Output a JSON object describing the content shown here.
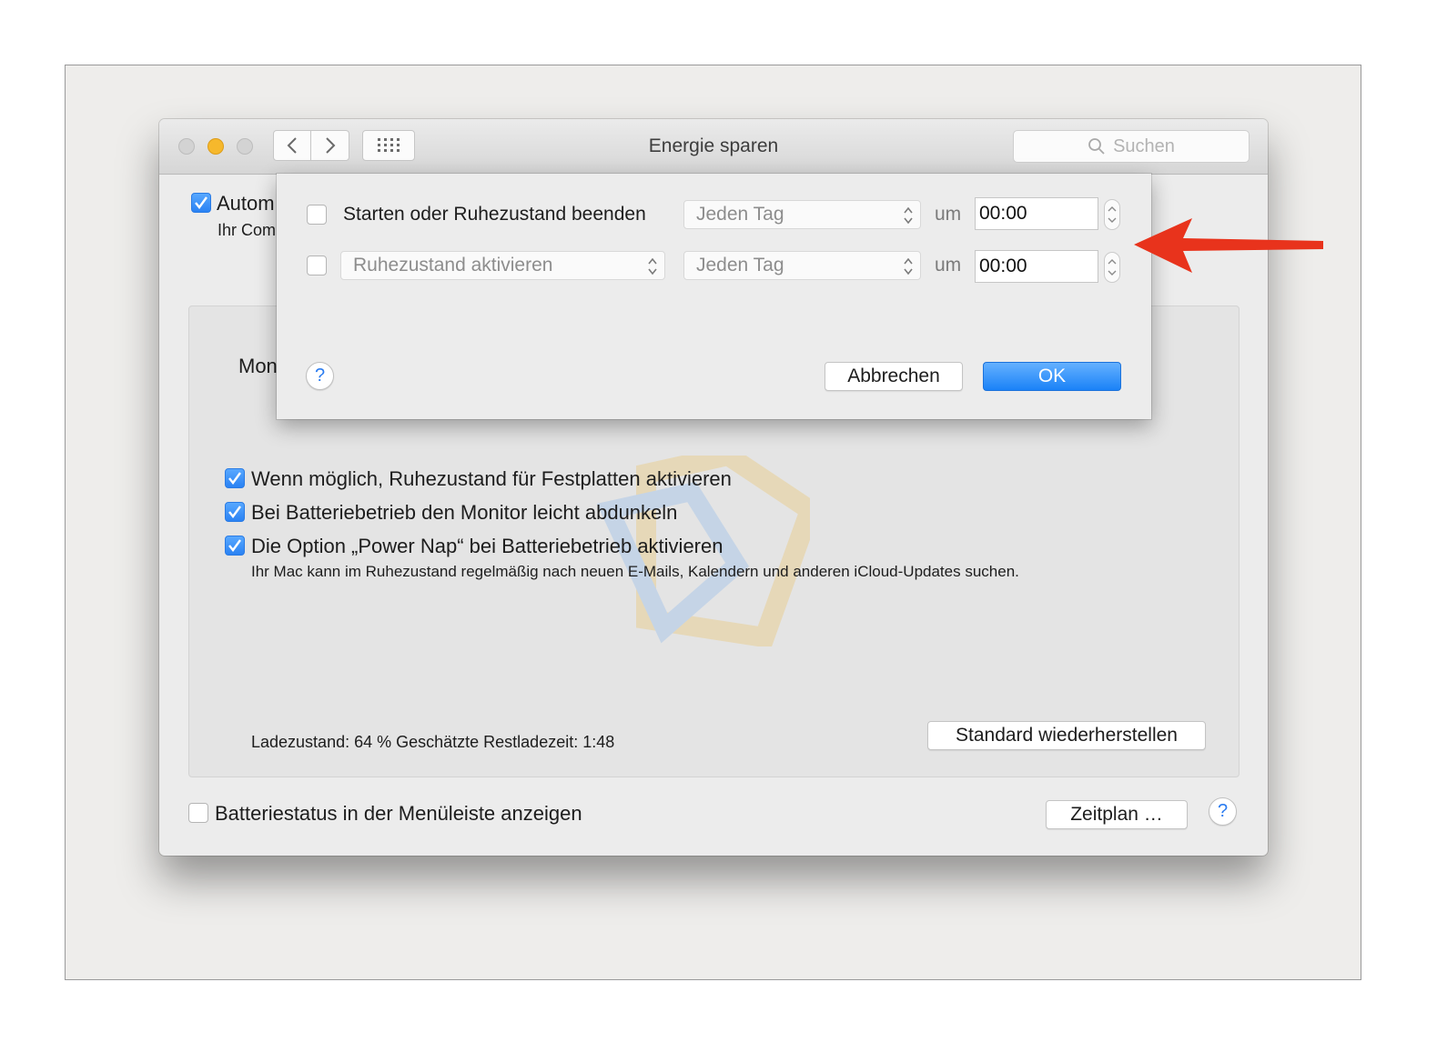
{
  "window": {
    "title": "Energie sparen",
    "search_placeholder": "Suchen"
  },
  "background": {
    "auto_label_partial": "Autom",
    "auto_subtext_partial": "Ihr Com",
    "monitor_label_partial": "Mon",
    "options": [
      {
        "label": "Wenn möglich, Ruhezustand für Festplatten aktivieren",
        "checked": true
      },
      {
        "label": "Bei Batteriebetrieb den Monitor leicht abdunkeln",
        "checked": true
      },
      {
        "label": "Die Option „Power Nap“ bei Batteriebetrieb aktivieren",
        "checked": true
      }
    ],
    "power_nap_description": "Ihr Mac kann im Ruhezustand regelmäßig nach neuen E-Mails, Kalendern und anderen iCloud-Updates suchen.",
    "battery_status": "Ladezustand: 64 %  Geschätzte Restladezeit: 1:48",
    "restore_button": "Standard wiederherstellen",
    "show_battery_status_label": "Batteriestatus in der Menüleiste anzeigen",
    "show_battery_status_checked": false,
    "schedule_button": "Zeitplan …",
    "help_glyph": "?"
  },
  "schedule_sheet": {
    "row1": {
      "checked": false,
      "label": "Starten oder Ruhezustand beenden",
      "day": "Jeden Tag",
      "at_label": "um",
      "time": "00:00"
    },
    "row2": {
      "checked": false,
      "action": "Ruhezustand aktivieren",
      "day": "Jeden Tag",
      "at_label": "um",
      "time": "00:00"
    },
    "cancel_button": "Abbrechen",
    "ok_button": "OK",
    "help_glyph": "?"
  },
  "colors": {
    "accent_blue": "#2a82f3",
    "annotation_arrow": "#e8331c",
    "minimize_yellow": "#f6b82c"
  }
}
